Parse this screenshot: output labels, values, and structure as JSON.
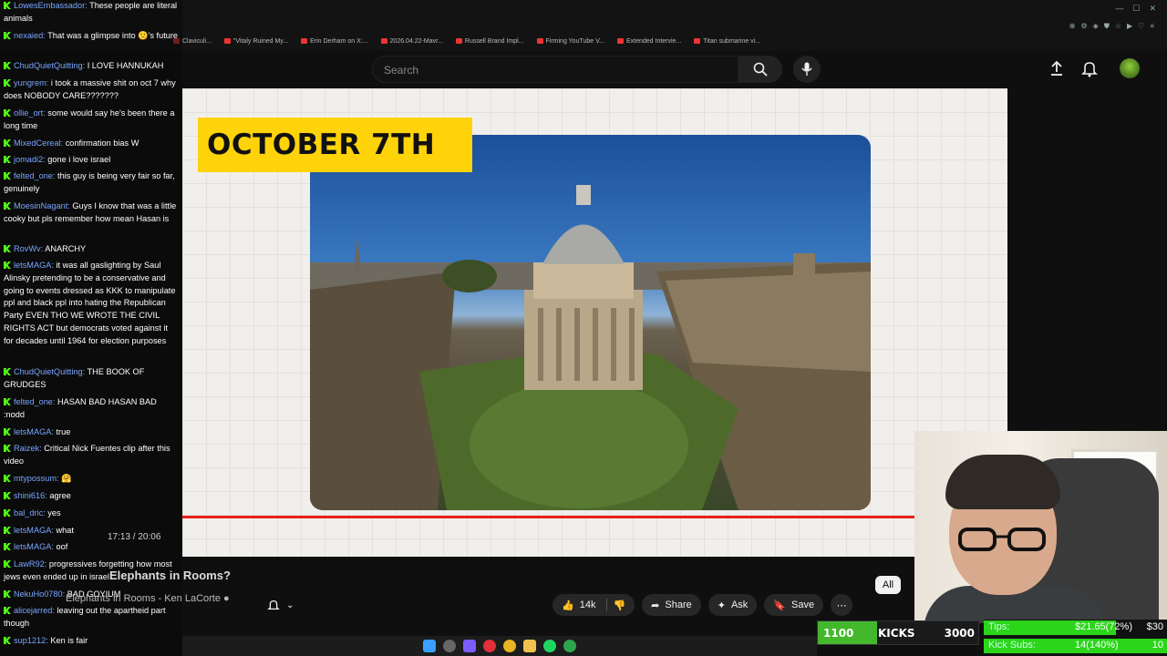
{
  "bookmarks": [
    "Claviculi...",
    "\"Vitaly Ruined My...",
    "Erin Derham on X:...",
    "2026.04.22-Mavr...",
    "Russell Brand Impl...",
    "Firming YouTube V...",
    "Extended Intervie...",
    "Titan submarine vi..."
  ],
  "search": {
    "placeholder": "Search"
  },
  "video": {
    "banner_text": "OCTOBER 7TH",
    "time": "17:13 / 20:06",
    "title": "Elephants in Rooms?"
  },
  "channel": {
    "name": "Elephants in Rooms - Ken LaCorte"
  },
  "actions": {
    "likes": "14k",
    "share": "Share",
    "ask": "Ask",
    "save": "Save"
  },
  "chips": {
    "all": "All"
  },
  "chat": [
    {
      "user": "LowesEmbassador:",
      "text": "These people are literal animals"
    },
    {
      "user": "nexaied:",
      "text": "That was a glimpse into 🙁's future"
    },
    {
      "user": "ChudQuietQuitting:",
      "text": "I LOVE HANNUKAH"
    },
    {
      "user": "yungrem:",
      "text": "i took a massive shit on oct 7 why does NOBODY CARE???????"
    },
    {
      "user": "ollie_ort:",
      "text": "some would say he's been there a long time"
    },
    {
      "user": "MixedCereal:",
      "text": "confirmation bias W"
    },
    {
      "user": "jomadi2:",
      "text": "gone i love israel"
    },
    {
      "user": "felted_one:",
      "text": "this guy is being very fair so far, genuinely"
    },
    {
      "user": "MoesinNagant:",
      "text": "Guys I know that was a little cooky but pls remember how mean Hasan is"
    },
    {
      "user": "RovWv:",
      "text": "ANARCHY"
    },
    {
      "user": "letsMAGA:",
      "text": "it was all gaslighting by Saul Alinsky pretending to be a conservative and going to events dressed as KKK to manipulate ppl and black ppl into hating the Republican Party EVEN THO WE WROTE THE CIVIL RIGHTS ACT but democrats voted against it for decades until 1964 for election purposes"
    },
    {
      "user": "ChudQuietQuitting:",
      "text": "THE BOOK OF GRUDGES"
    },
    {
      "user": "felted_one:",
      "text": "HASAN BAD HASAN BAD :nodd"
    },
    {
      "user": "letsMAGA:",
      "text": "true"
    },
    {
      "user": "Raizek:",
      "text": "Critical Nick Fuentes clip after this video"
    },
    {
      "user": "mtypossum:",
      "text": "🤗"
    },
    {
      "user": "shini616:",
      "text": "agree"
    },
    {
      "user": "bal_dric:",
      "text": "yes"
    },
    {
      "user": "letsMAGA:",
      "text": "what"
    },
    {
      "user": "letsMAGA:",
      "text": "oof"
    },
    {
      "user": "LawR92:",
      "text": "progressives forgetting how most jews even ended up in israel"
    },
    {
      "user": "NekuHo0780:",
      "text": "BAD GOYIUM"
    },
    {
      "user": "alicejarred:",
      "text": "leaving out the apartheid part though"
    },
    {
      "user": "sup1212:",
      "text": "Ken is fair"
    }
  ],
  "kick_goal": {
    "current": "1100",
    "label": "KICKS",
    "target": "3000",
    "progress": 0.37
  },
  "tips": {
    "tips_label": "Tips:",
    "tips_amount": "$21.65(72%)",
    "tips_goal": "$30",
    "tips_progress": 0.72,
    "subs_label": "Kick Subs:",
    "subs_amount": "14(140%)",
    "subs_goal": "10",
    "subs_progress": 1.0
  },
  "colors": {
    "accent_red": "#e62117",
    "kick_green": "#53fc18",
    "banner_yellow": "#ffd30a"
  }
}
